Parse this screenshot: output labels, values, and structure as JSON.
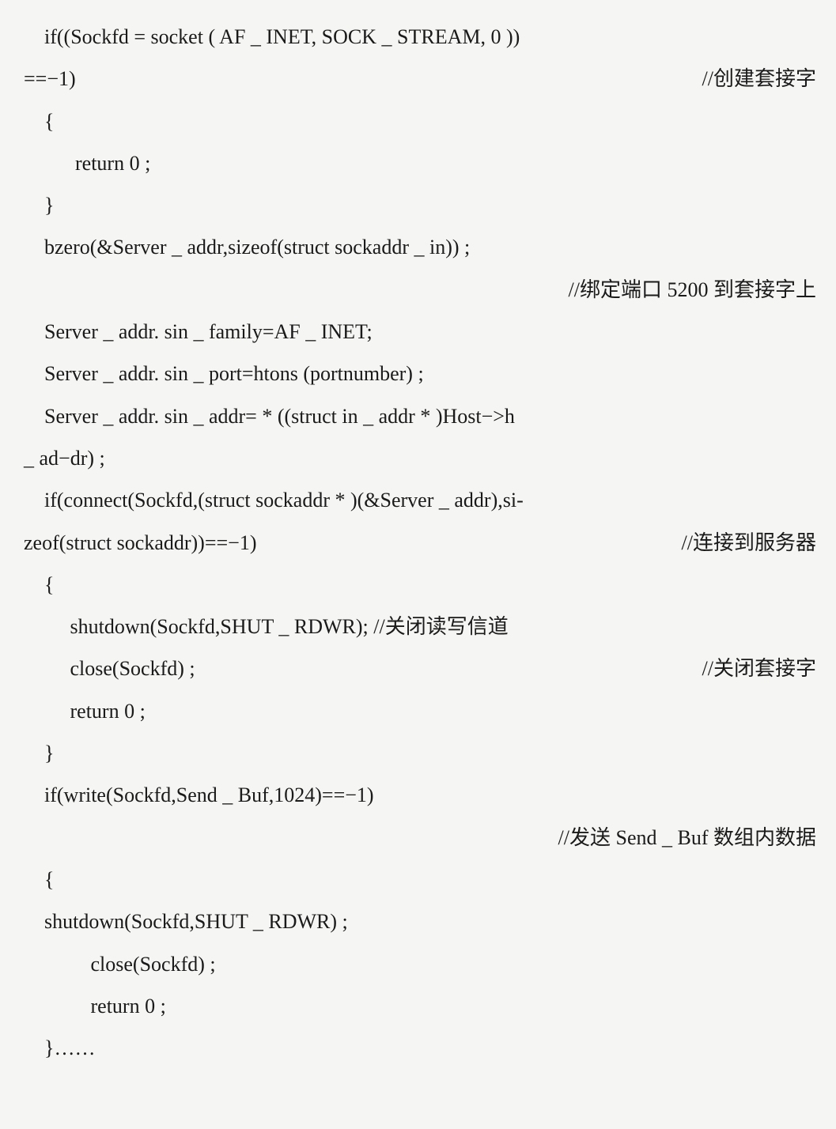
{
  "lines": [
    {
      "left": "    if((Sockfd = socket ( AF _ INET, SOCK _ STREAM, 0 ))",
      "right": "",
      "cls": ""
    },
    {
      "left": "==−1)",
      "right": "//创建套接字",
      "cls": ""
    },
    {
      "left": "    {",
      "right": "",
      "cls": ""
    },
    {
      "left": "          return 0 ;",
      "right": "",
      "cls": ""
    },
    {
      "left": "    }",
      "right": "",
      "cls": ""
    },
    {
      "left": "    bzero(&Server _ addr,sizeof(struct sockaddr _ in)) ;",
      "right": "",
      "cls": ""
    },
    {
      "left": "",
      "right": "//绑定端口 5200 到套接字上",
      "cls": ""
    },
    {
      "left": "    Server _ addr. sin _ family=AF _ INET;",
      "right": "",
      "cls": ""
    },
    {
      "left": "    Server _ addr. sin _ port=htons (portnumber) ;",
      "right": "",
      "cls": ""
    },
    {
      "left": "    Server _ addr. sin _ addr= * ((struct in _ addr * )Host−>h",
      "right": "",
      "cls": ""
    },
    {
      "left": "_ ad−dr) ;",
      "right": "",
      "cls": ""
    },
    {
      "left": "    if(connect(Sockfd,(struct sockaddr * )(&Server _ addr),si-",
      "right": "",
      "cls": ""
    },
    {
      "left": "zeof(struct sockaddr))==−1)",
      "right": "//连接到服务器",
      "cls": ""
    },
    {
      "left": "    {",
      "right": "",
      "cls": ""
    },
    {
      "left": "         shutdown(Sockfd,SHUT _ RDWR); //关闭读写信道",
      "right": "",
      "cls": ""
    },
    {
      "left": "         close(Sockfd) ;",
      "right": "//关闭套接字",
      "cls": ""
    },
    {
      "left": "         return 0 ;",
      "right": "",
      "cls": ""
    },
    {
      "left": "    }",
      "right": "",
      "cls": ""
    },
    {
      "left": "    if(write(Sockfd,Send _ Buf,1024)==−1)",
      "right": "",
      "cls": ""
    },
    {
      "left": "",
      "right": "//发送 Send _ Buf 数组内数据",
      "cls": ""
    },
    {
      "left": "    {",
      "right": "",
      "cls": ""
    },
    {
      "left": "    shutdown(Sockfd,SHUT _ RDWR) ;",
      "right": "",
      "cls": ""
    },
    {
      "left": "             close(Sockfd) ;",
      "right": "",
      "cls": ""
    },
    {
      "left": "             return 0 ;",
      "right": "",
      "cls": ""
    },
    {
      "left": "    }……",
      "right": "",
      "cls": ""
    }
  ]
}
